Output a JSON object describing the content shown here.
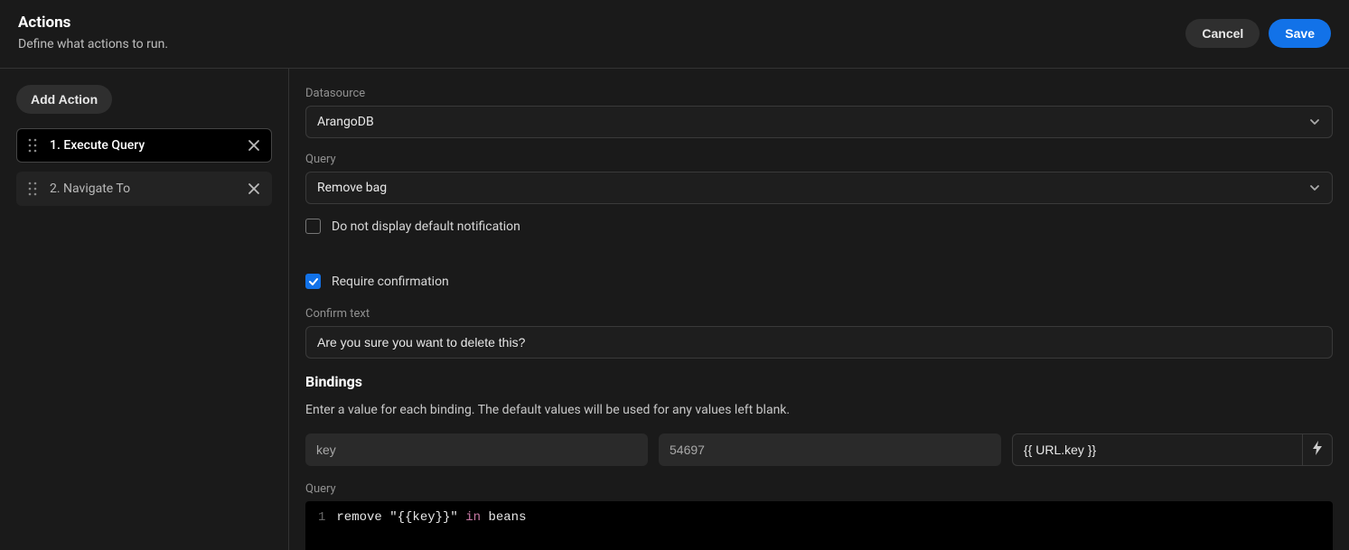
{
  "header": {
    "title": "Actions",
    "subtitle": "Define what actions to run.",
    "cancel": "Cancel",
    "save": "Save"
  },
  "sidebar": {
    "add_label": "Add Action",
    "items": [
      {
        "label": "1. Execute Query",
        "selected": true
      },
      {
        "label": "2. Navigate To",
        "selected": false
      }
    ]
  },
  "form": {
    "datasource_label": "Datasource",
    "datasource_value": "ArangoDB",
    "query_label": "Query",
    "query_value": "Remove bag",
    "notify_label": "Do not display default notification",
    "notify_checked": false,
    "confirm_label": "Require confirmation",
    "confirm_checked": true,
    "confirm_text_label": "Confirm text",
    "confirm_text_value": "Are you sure you want to delete this?",
    "bindings_title": "Bindings",
    "bindings_desc": "Enter a value for each binding. The default values will be used for any values left blank.",
    "binding": {
      "name": "key",
      "default": "54697",
      "value": "{{ URL.key }}"
    },
    "query2_label": "Query",
    "code": {
      "line_no": "1",
      "t1": "remove ",
      "t2": "\"{{key}}\"",
      "t3": " in",
      "t4": " beans"
    }
  }
}
